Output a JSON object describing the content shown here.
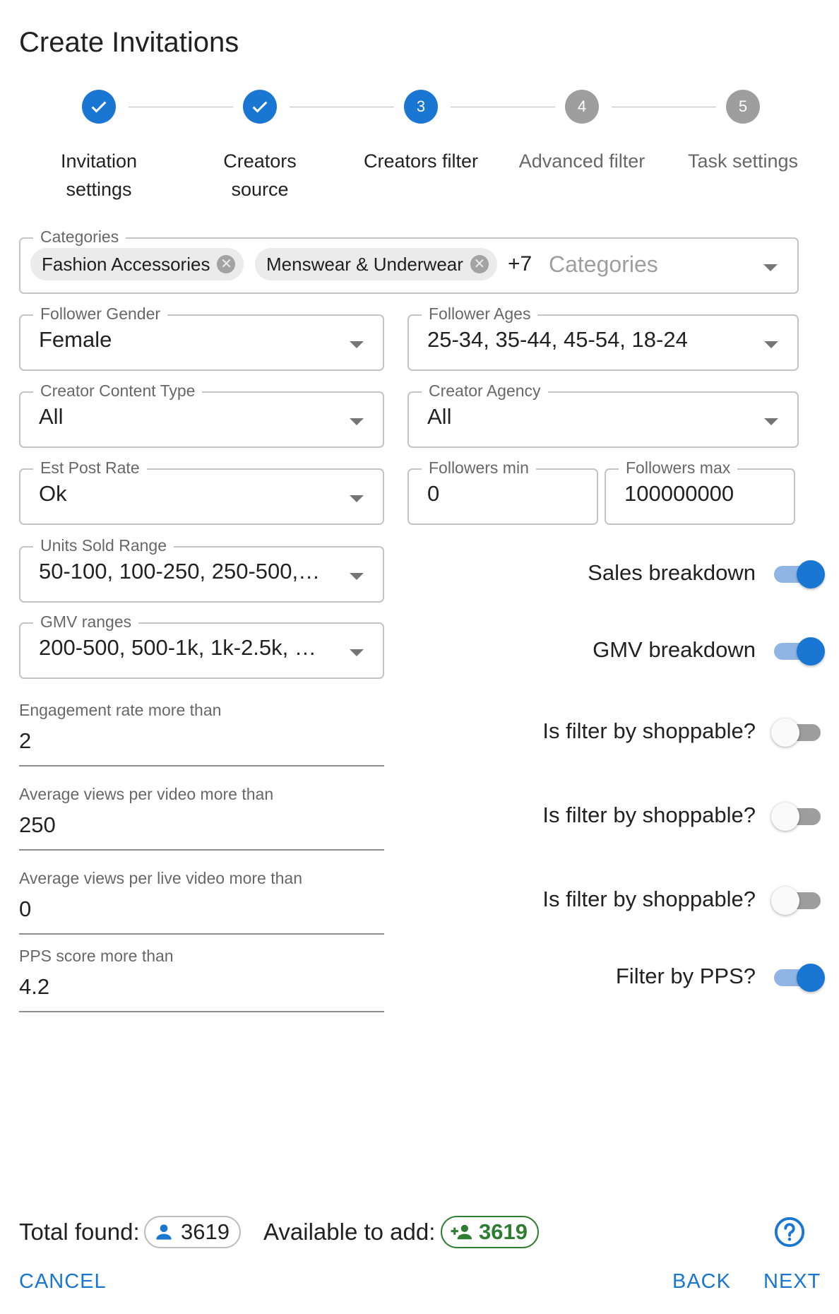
{
  "title": "Create Invitations",
  "stepper": [
    {
      "number": "1",
      "label_line1": "Invitation",
      "label_line2": "settings",
      "state": "done"
    },
    {
      "number": "2",
      "label_line1": "Creators",
      "label_line2": "source",
      "state": "done"
    },
    {
      "number": "3",
      "label_line1": "Creators filter",
      "label_line2": "",
      "state": "active"
    },
    {
      "number": "4",
      "label_line1": "Advanced filter",
      "label_line2": "",
      "state": "todo"
    },
    {
      "number": "5",
      "label_line1": "Task settings",
      "label_line2": "",
      "state": "todo"
    }
  ],
  "categories": {
    "label": "Categories",
    "chips": [
      "Fashion Accessories",
      "Menswear & Underwear"
    ],
    "more": "+7",
    "placeholder": "Categories"
  },
  "follower_gender": {
    "label": "Follower Gender",
    "value": "Female"
  },
  "follower_ages": {
    "label": "Follower Ages",
    "value": "25-34, 35-44, 45-54, 18-24"
  },
  "creator_content_type": {
    "label": "Creator Content Type",
    "value": "All"
  },
  "creator_agency": {
    "label": "Creator Agency",
    "value": "All"
  },
  "est_post_rate": {
    "label": "Est Post Rate",
    "value": "Ok"
  },
  "followers_min": {
    "label": "Followers min",
    "value": "0"
  },
  "followers_max": {
    "label": "Followers max",
    "value": "100000000"
  },
  "units_sold_range": {
    "label": "Units Sold Range",
    "value": "50-100, 100-250, 250-500,…"
  },
  "gmv_ranges": {
    "label": "GMV ranges",
    "value": "200-500, 500-1k, 1k-2.5k, …"
  },
  "engagement_rate": {
    "label": "Engagement rate more than",
    "value": "2"
  },
  "avg_views_video": {
    "label": "Average views per video more than",
    "value": "250"
  },
  "avg_views_live": {
    "label": "Average views per live video more than",
    "value": "0"
  },
  "pps_score": {
    "label": "PPS score more than",
    "value": "4.2"
  },
  "switches": {
    "sales_breakdown": {
      "label": "Sales breakdown",
      "checked": true
    },
    "gmv_breakdown": {
      "label": "GMV breakdown",
      "checked": true
    },
    "shoppable_1": {
      "label": "Is filter by shoppable?",
      "checked": false
    },
    "shoppable_2": {
      "label": "Is filter by shoppable?",
      "checked": false
    },
    "shoppable_3": {
      "label": "Is filter by shoppable?",
      "checked": false
    },
    "filter_pps": {
      "label": "Filter by PPS?",
      "checked": true
    }
  },
  "footer": {
    "total_found_label": "Total found:",
    "total_found_value": "3619",
    "available_label": "Available to add:",
    "available_value": "3619",
    "cancel": "CANCEL",
    "back": "BACK",
    "next": "NEXT"
  },
  "colors": {
    "primary": "#1976d2",
    "success": "#2e7d32",
    "inactive_step": "#9e9e9e"
  }
}
